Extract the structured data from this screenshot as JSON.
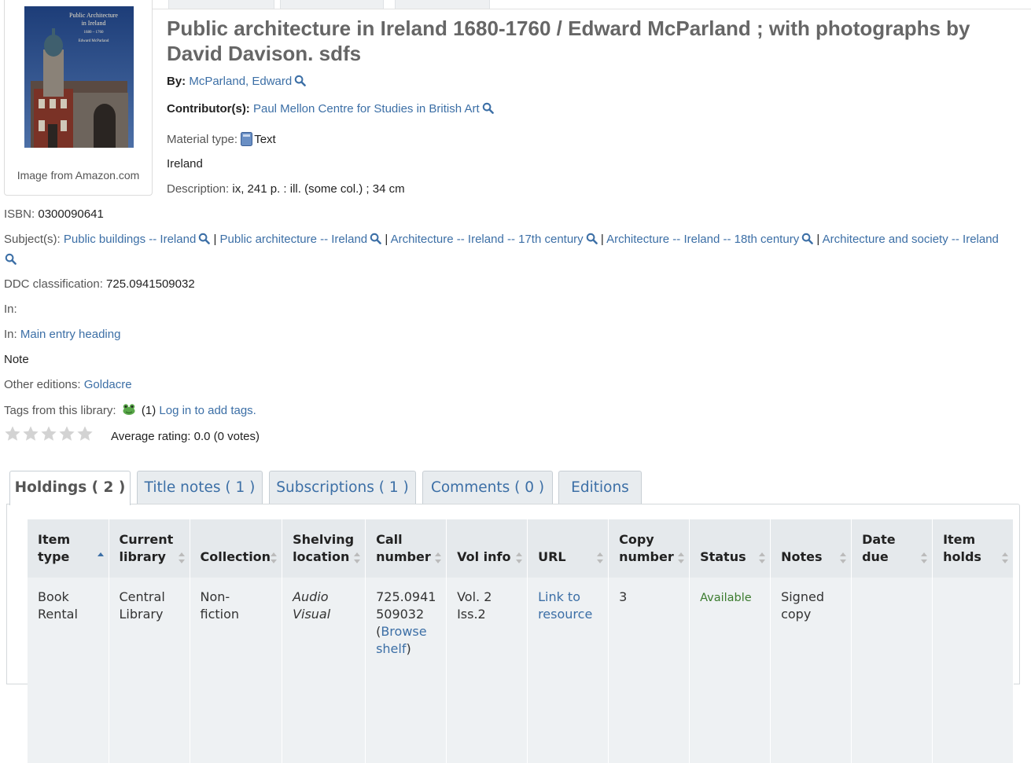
{
  "record": {
    "title": "Public architecture in Ireland 1680-1760 / Edward McParland ; with photographs by David Davison. sdfs",
    "cover_caption": "Image from Amazon.com",
    "cover_title_line1": "Public Architecture",
    "cover_title_line2": "in Ireland",
    "cover_subtitle": "1680 – 1760",
    "cover_author": "Edward McParland",
    "by_label": "By:",
    "author": "McParland, Edward",
    "contributor_label": "Contributor(s):",
    "contributor": "Paul Mellon Centre for Studies in British Art",
    "material_label": "Material type:",
    "material_value": "Text",
    "place": "Ireland",
    "description_label": "Description:",
    "description": "ix, 241 p. : ill. (some col.) ; 34 cm",
    "isbn_label": "ISBN:",
    "isbn": "0300090641",
    "subjects_label": "Subject(s):",
    "subjects": [
      "Public buildings -- Ireland",
      "Public architecture -- Ireland",
      "Architecture -- Ireland -- 17th century",
      "Architecture -- Ireland -- 18th century",
      "Architecture and society -- Ireland"
    ],
    "separator": "|",
    "ddc_label": "DDC classification:",
    "ddc": "725.0941509032",
    "in_label": "In:",
    "in_link": "Main entry heading",
    "note": "Note",
    "other_editions_label": "Other editions:",
    "other_editions": "Goldacre",
    "tags_label": "Tags from this library:",
    "tags_count": "(1)",
    "tags_login": "Log in to add tags.",
    "rating_text": "Average rating: 0.0 (0 votes)",
    "rating_value": 0,
    "rating_max": 5
  },
  "tabs": [
    {
      "label": "Holdings ( 2 )",
      "active": true
    },
    {
      "label": "Title notes ( 1 )",
      "active": false
    },
    {
      "label": "Subscriptions ( 1 )",
      "active": false
    },
    {
      "label": "Comments ( 0 )",
      "active": false
    },
    {
      "label": "Editions",
      "active": false
    }
  ],
  "holdings": {
    "columns": {
      "item_type": [
        "Item",
        "type"
      ],
      "current_library": [
        "Current",
        "library"
      ],
      "collection": "Collection",
      "shelving_location": [
        "Shelving",
        "location"
      ],
      "call_number": [
        "Call",
        "number"
      ],
      "vol_info": "Vol info",
      "url": "URL",
      "copy_number": [
        "Copy",
        "number"
      ],
      "status": "Status",
      "notes": "Notes",
      "date_due": [
        "Date",
        "due"
      ],
      "item_holds": [
        "Item",
        "holds"
      ]
    },
    "rows": [
      {
        "item_type": [
          "Book",
          "Rental"
        ],
        "current_library": [
          "Central",
          "Library"
        ],
        "collection": [
          "Non-",
          "fiction"
        ],
        "shelving_location": [
          "Audio",
          "Visual"
        ],
        "call_number": [
          "725.0941",
          "509032"
        ],
        "browse_open": "(",
        "browse_link": [
          "Browse",
          "shelf"
        ],
        "browse_close": ")",
        "vol_info": [
          "Vol. 2",
          "Iss.2"
        ],
        "url": [
          "Link to",
          "resource"
        ],
        "copy_number": "3",
        "status": "Available",
        "notes": [
          "Signed",
          "copy"
        ],
        "date_due": "",
        "item_holds": ""
      }
    ]
  },
  "colors": {
    "link": "#3c6fa6",
    "available": "#3b7b2e",
    "title": "#666666"
  }
}
